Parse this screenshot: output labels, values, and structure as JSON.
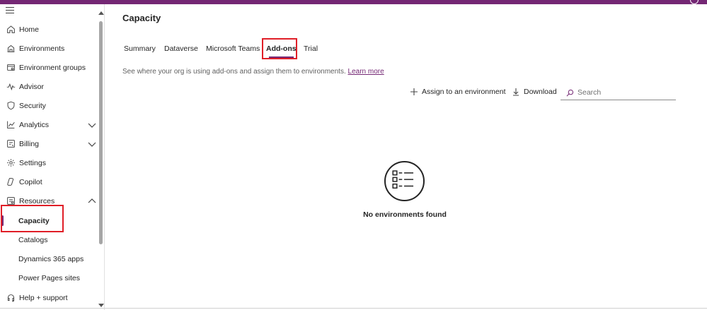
{
  "sidebar": {
    "items": [
      {
        "label": "Home",
        "icon": "home-icon"
      },
      {
        "label": "Environments",
        "icon": "environments-icon"
      },
      {
        "label": "Environment groups",
        "icon": "environment-groups-icon"
      },
      {
        "label": "Advisor",
        "icon": "advisor-icon"
      },
      {
        "label": "Security",
        "icon": "shield-icon"
      },
      {
        "label": "Analytics",
        "icon": "analytics-icon",
        "expandable": true
      },
      {
        "label": "Billing",
        "icon": "billing-icon",
        "expandable": true
      },
      {
        "label": "Settings",
        "icon": "gear-icon"
      },
      {
        "label": "Copilot",
        "icon": "copilot-icon"
      },
      {
        "label": "Resources",
        "icon": "resources-icon",
        "expanded": true
      },
      {
        "label": "Capacity",
        "sub": true,
        "selected": true
      },
      {
        "label": "Catalogs",
        "sub": true
      },
      {
        "label": "Dynamics 365 apps",
        "sub": true
      },
      {
        "label": "Power Pages sites",
        "sub": true
      },
      {
        "label": "Help + support",
        "icon": "headset-icon"
      }
    ]
  },
  "main": {
    "title": "Capacity",
    "tabs": [
      {
        "label": "Summary"
      },
      {
        "label": "Dataverse"
      },
      {
        "label": "Microsoft Teams"
      },
      {
        "label": "Add-ons",
        "active": true
      },
      {
        "label": "Trial"
      }
    ],
    "description": "See where your org is using add-ons and assign them to environments.",
    "learn_more": "Learn more",
    "toolbar": {
      "assign_label": "Assign to an environment",
      "download_label": "Download",
      "search_placeholder": "Search"
    },
    "empty_state": {
      "icon": "list-icon",
      "text": "No environments found"
    }
  },
  "colors": {
    "accent": "#742774",
    "highlight_box": "#e01e27"
  }
}
